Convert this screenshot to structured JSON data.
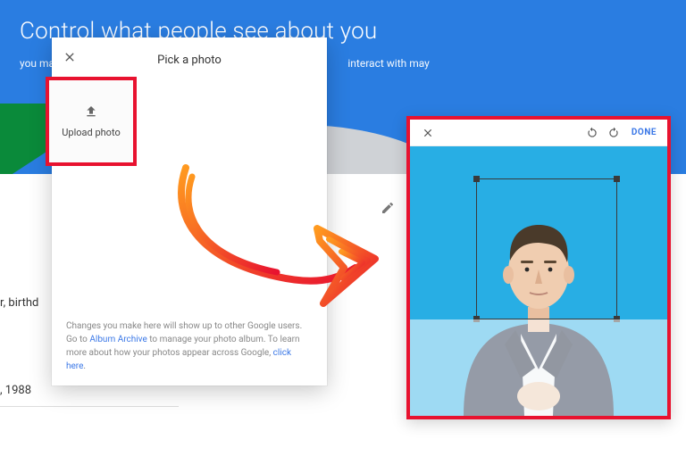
{
  "header": {
    "title": "Control what people see about you",
    "subtitle_left": "you make",
    "subtitle_right": "interact with may"
  },
  "background": {
    "label_partial": "r, birthd",
    "date_partial": ", 1988"
  },
  "pickPhotoModal": {
    "title": "Pick a photo",
    "close_label": "Close",
    "upload_label": "Upload photo",
    "footer_part1": "Changes you make here will show up to other Google users. Go to ",
    "footer_link1": "Album Archive",
    "footer_part2": " to manage your photo album. To learn more about how your photos appear across Google, ",
    "footer_link2": "click here",
    "footer_part3": "."
  },
  "cropDialog": {
    "close_label": "Close",
    "rotate_left_label": "Rotate left",
    "rotate_right_label": "Rotate right",
    "done_label": "DONE"
  },
  "annotation": {
    "highlight_color": "#e8122f",
    "arrow_gradient_start": "#ff9a1f",
    "arrow_gradient_end": "#e8122f"
  }
}
